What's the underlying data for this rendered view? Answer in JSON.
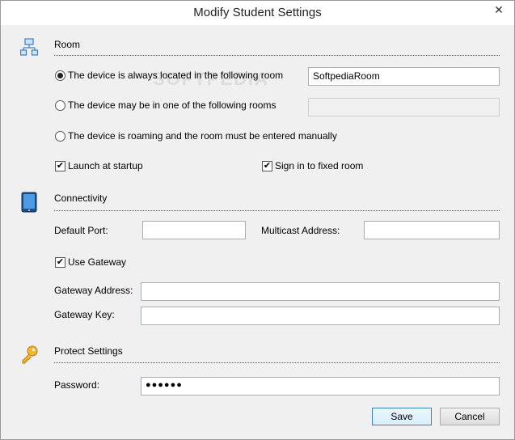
{
  "window": {
    "title": "Modify Student Settings",
    "close_glyph": "✕"
  },
  "watermark": "SOFTPEDIA",
  "room": {
    "section_label": "Room",
    "icon": "network-icon",
    "options": [
      {
        "label": "The device is always located in the following room",
        "selected": true
      },
      {
        "label": "The device may be in one of the following rooms",
        "selected": false
      },
      {
        "label": "The device is roaming and the room must be entered manually",
        "selected": false
      }
    ],
    "room_value": "SoftpediaRoom",
    "rooms_list_value": "",
    "launch_at_startup": {
      "label": "Launch at startup",
      "checked": true
    },
    "sign_in_fixed_room": {
      "label": "Sign in to fixed room",
      "checked": true
    }
  },
  "connectivity": {
    "section_label": "Connectivity",
    "icon": "tablet-icon",
    "default_port_label": "Default Port:",
    "default_port_value": "",
    "multicast_label": "Multicast Address:",
    "multicast_value": "",
    "use_gateway": {
      "label": "Use Gateway",
      "checked": true
    },
    "gateway_address_label": "Gateway Address:",
    "gateway_address_value": "",
    "gateway_key_label": "Gateway Key:",
    "gateway_key_value": ""
  },
  "protect": {
    "section_label": "Protect Settings",
    "icon": "key-icon",
    "password_label": "Password:",
    "password_value": "●●●●●●"
  },
  "buttons": {
    "save": "Save",
    "cancel": "Cancel"
  },
  "colors": {
    "key_icon": "#e3a21a",
    "tablet_icon": "#2b78c5",
    "network_icon": "#3d7fc4"
  },
  "check_glyph": "✔"
}
